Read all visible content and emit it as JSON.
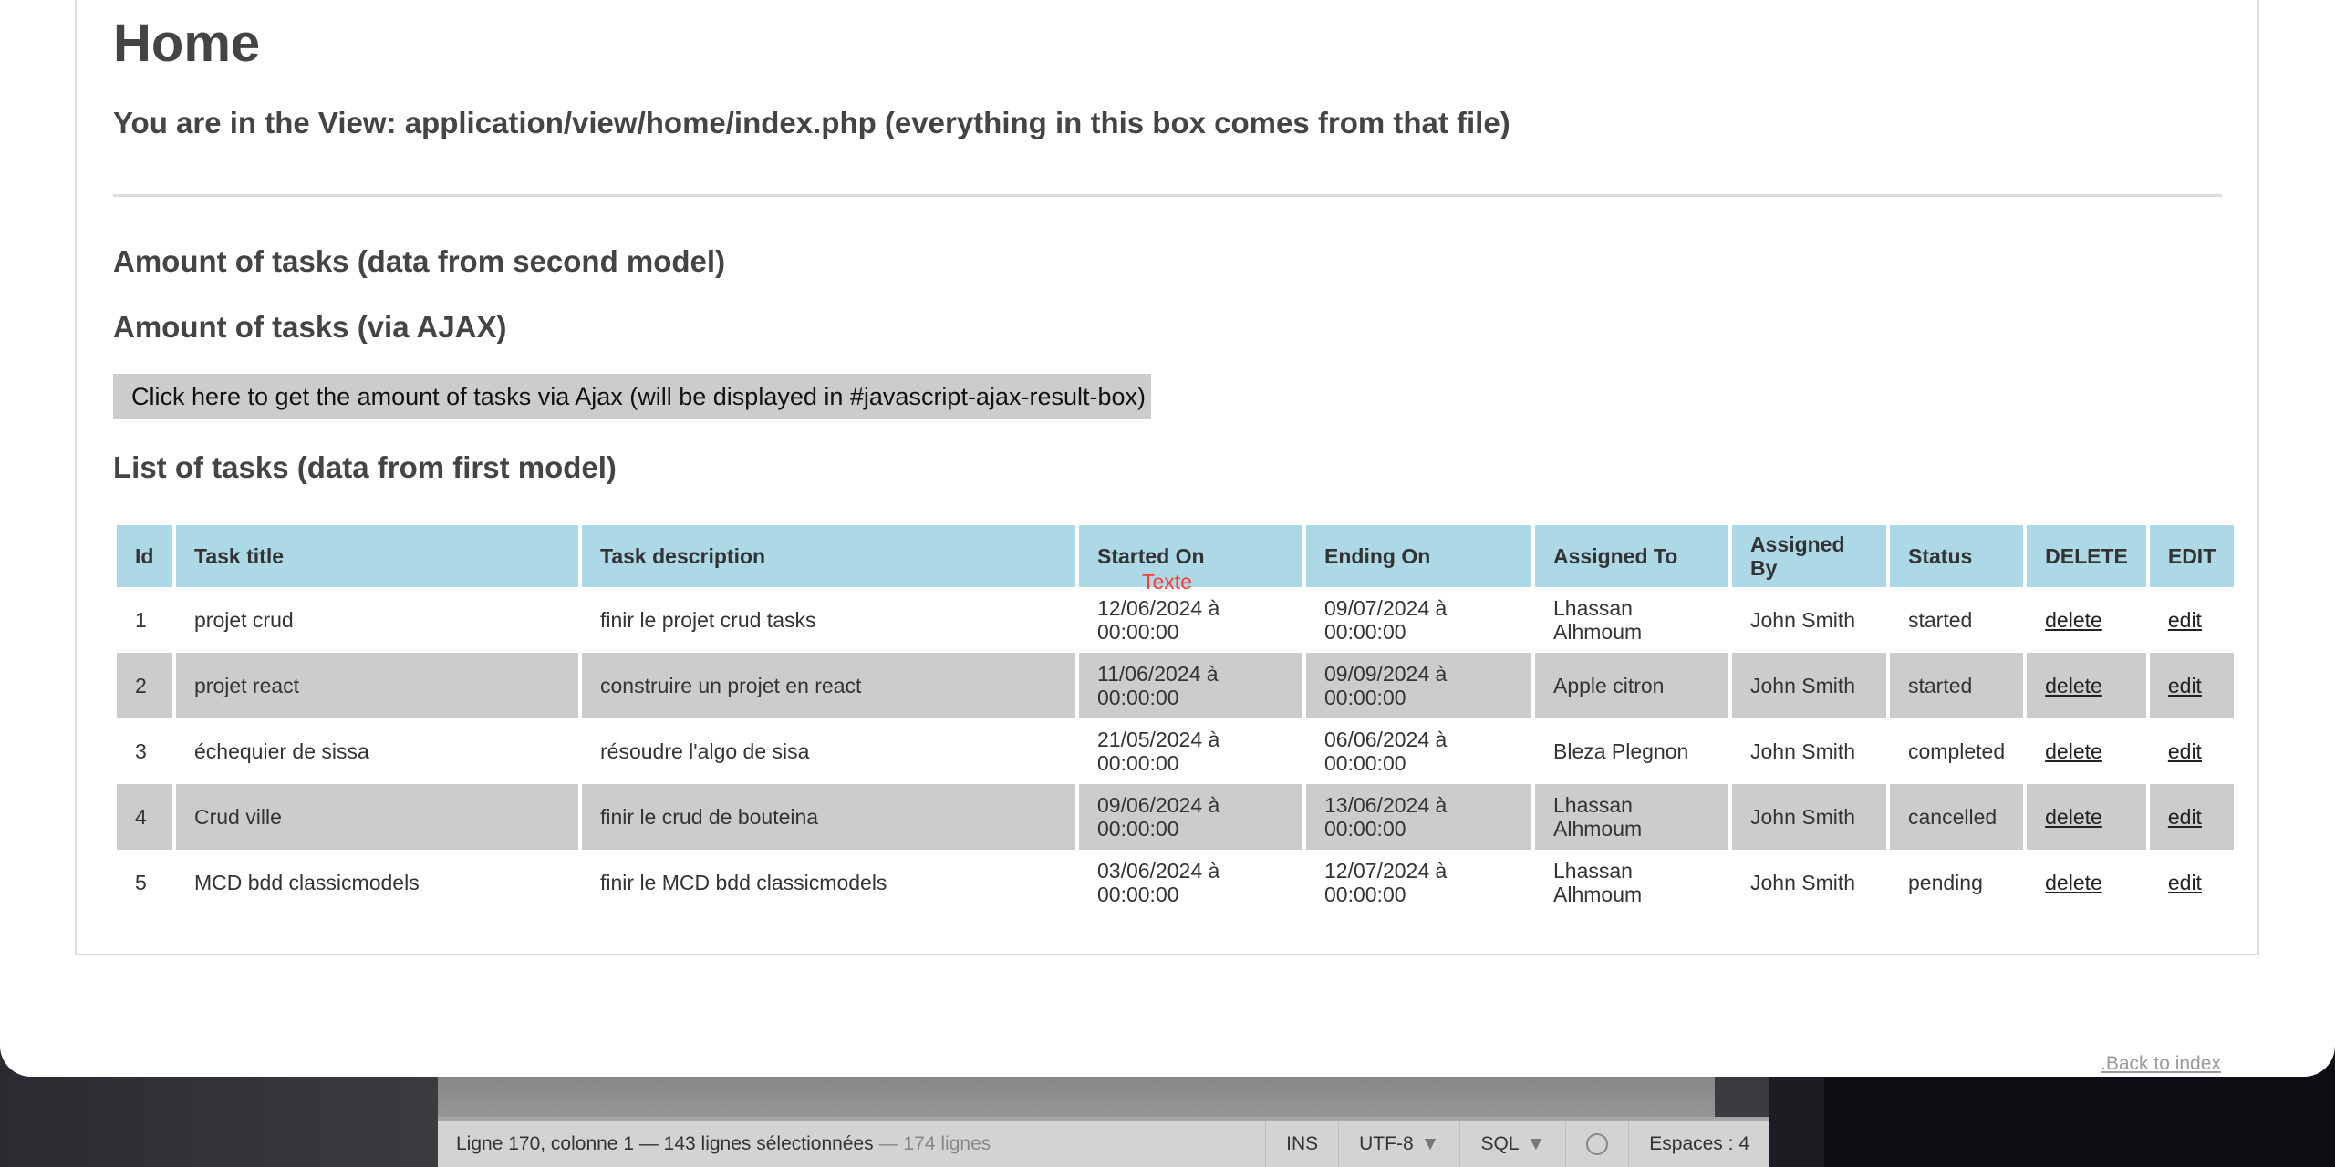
{
  "page": {
    "title": "Home",
    "subtitle": "You are in the View: application/view/home/index.php (everything in this box comes from that file)",
    "amount_second_model": "Amount of tasks (data from second model)",
    "amount_ajax": "Amount of tasks (via AJAX)",
    "ajax_button": "Click here to get the amount of tasks via Ajax (will be displayed in #javascript-ajax-result-box)",
    "list_heading": "List of tasks (data from first model)",
    "overlay_text": "Texte",
    "back_link": ".Back to index"
  },
  "table": {
    "headers": [
      "Id",
      "Task title",
      "Task description",
      "Started On",
      "Ending On",
      "Assigned To",
      "Assigned By",
      "Status",
      "DELETE",
      "EDIT"
    ],
    "rows": [
      {
        "id": "1",
        "title": "projet crud",
        "description": "finir le projet crud tasks",
        "started": "12/06/2024 à 00:00:00",
        "ending": "09/07/2024 à 00:00:00",
        "assigned_to": "Lhassan Alhmoum",
        "assigned_by": "John Smith",
        "status": "started",
        "delete": "delete",
        "edit": "edit"
      },
      {
        "id": "2",
        "title": "projet react",
        "description": "construire un projet en react",
        "started": "11/06/2024 à 00:00:00",
        "ending": "09/09/2024 à 00:00:00",
        "assigned_to": "Apple citron",
        "assigned_by": "John Smith",
        "status": "started",
        "delete": "delete",
        "edit": "edit"
      },
      {
        "id": "3",
        "title": "échequier de sissa",
        "description": "résoudre l'algo de sisa",
        "started": "21/05/2024 à 00:00:00",
        "ending": "06/06/2024 à 00:00:00",
        "assigned_to": "Bleza Plegnon",
        "assigned_by": "John Smith",
        "status": "completed",
        "delete": "delete",
        "edit": "edit"
      },
      {
        "id": "4",
        "title": "Crud ville",
        "description": "finir le crud de bouteina",
        "started": "09/06/2024 à 00:00:00",
        "ending": "13/06/2024 à 00:00:00",
        "assigned_to": "Lhassan Alhmoum",
        "assigned_by": "John Smith",
        "status": "cancelled",
        "delete": "delete",
        "edit": "edit"
      },
      {
        "id": "5",
        "title": "MCD bdd classicmodels",
        "description": "finir le MCD bdd classicmodels",
        "started": "03/06/2024 à 00:00:00",
        "ending": "12/07/2024 à 00:00:00",
        "assigned_to": "Lhassan Alhmoum",
        "assigned_by": "John Smith",
        "status": "pending",
        "delete": "delete",
        "edit": "edit"
      }
    ]
  },
  "editor_status": {
    "position": "Ligne 170, colonne 1 — 143 lignes sélectionnées",
    "total": "— 174 lignes",
    "mode": "INS",
    "encoding": "UTF-8",
    "language": "SQL",
    "indent": "Espaces : 4"
  },
  "colors": {
    "header_bg": "#add8e6",
    "alt_row": "#cccccc",
    "accent_red": "#ff3b30"
  }
}
